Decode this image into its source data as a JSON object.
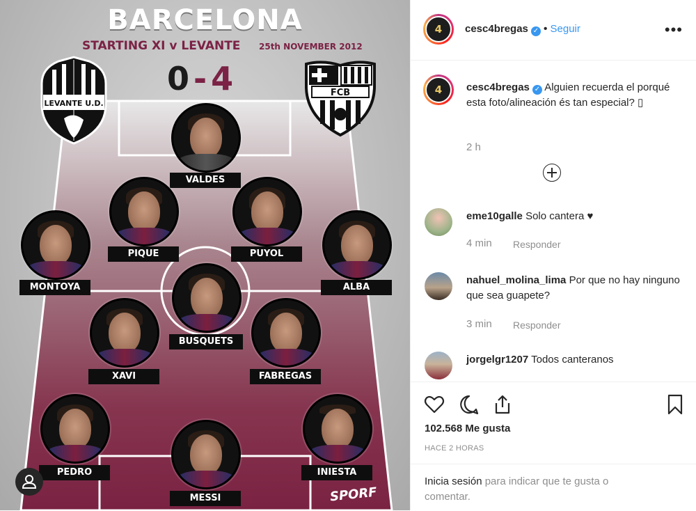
{
  "graphic": {
    "title": "BARCELONA",
    "subtitle": "STARTING XI v LEVANTE",
    "date": "25th NOVEMBER 2012",
    "score": {
      "home": "0",
      "dash": "-",
      "away": "4"
    },
    "crest_home": "LEVANTE U.D.",
    "crest_away": "FCB",
    "watermark": "SPORF",
    "players": [
      "VALDES",
      "PIQUE",
      "PUYOL",
      "MONTOYA",
      "ALBA",
      "BUSQUETS",
      "XAVI",
      "FABREGAS",
      "PEDRO",
      "INIESTA",
      "MESSI"
    ]
  },
  "post": {
    "header": {
      "username": "cesc4bregas",
      "verified_icon": "verified-badge-icon",
      "separator": "•",
      "follow": "Seguir",
      "more": "•••",
      "avatar_text": "4"
    },
    "caption": {
      "username": "cesc4bregas",
      "text": "Alguien recuerda el porqué esta foto/alineación és tan especial? ▯",
      "time": "2 h"
    },
    "comments": [
      {
        "username": "eme10galle",
        "text": "Solo cantera ♥",
        "time": "4 min",
        "reply": "Responder"
      },
      {
        "username": "nahuel_molina_lima",
        "text": "Por que no hay ninguno que sea guapete?",
        "time": "3 min",
        "reply": "Responder"
      },
      {
        "username": "jorgelgr1207",
        "text": "Todos canteranos"
      }
    ],
    "likes": "102.568 Me gusta",
    "posted": "HACE 2 HORAS",
    "login": {
      "link": "Inicia sesión",
      "rest": " para indicar que te gusta o comentar."
    }
  }
}
